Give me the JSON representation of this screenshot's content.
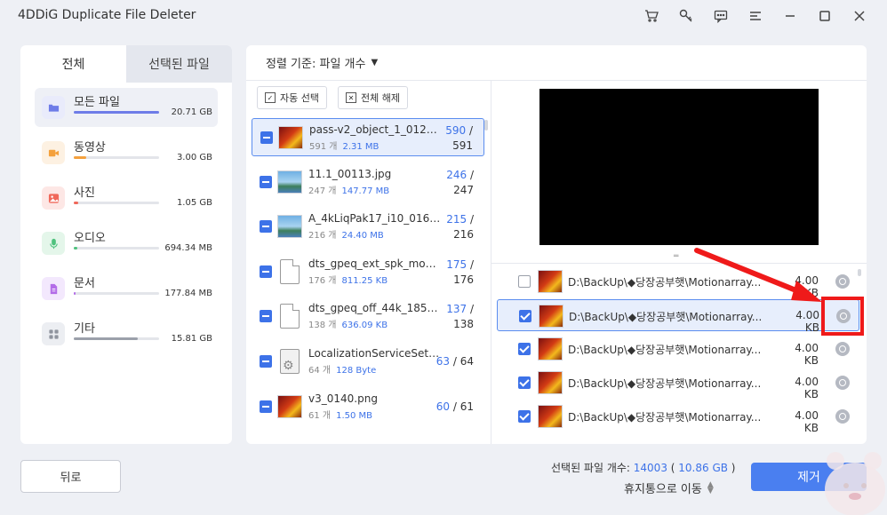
{
  "app": {
    "title": "4DDiG Duplicate File Deleter"
  },
  "titlebar_icons": [
    "cart-icon",
    "key-icon",
    "feedback-icon",
    "menu-icon",
    "minimize-icon",
    "maximize-icon",
    "close-icon"
  ],
  "tabs": {
    "all": "전체",
    "selected": "선택된 파일"
  },
  "categories": [
    {
      "name": "모든 파일",
      "size": "20.71 GB",
      "fill": 1.0,
      "color": "#6e7ce8",
      "icon": "folder-icon",
      "bg": "#e9ebfb"
    },
    {
      "name": "동영상",
      "size": "3.00 GB",
      "fill": 0.15,
      "color": "#f4a13d",
      "icon": "video-icon",
      "bg": "#fdf1e2"
    },
    {
      "name": "사진",
      "size": "1.05 GB",
      "fill": 0.05,
      "color": "#f0685a",
      "icon": "image-icon",
      "bg": "#fde7e5"
    },
    {
      "name": "오디오",
      "size": "694.34 MB",
      "fill": 0.04,
      "color": "#4fc27e",
      "icon": "microphone-icon",
      "bg": "#e4f6ea"
    },
    {
      "name": "문서",
      "size": "177.84 MB",
      "fill": 0.02,
      "color": "#b36ce8",
      "icon": "document-icon",
      "bg": "#f3e8fd"
    },
    {
      "name": "기타",
      "size": "15.81 GB",
      "fill": 0.75,
      "color": "#9ba0aa",
      "icon": "grid-icon",
      "bg": "#eceef2"
    }
  ],
  "sort": {
    "label": "정렬 기준: 파일 개수"
  },
  "toolbar": {
    "auto_select": "자동 선택",
    "deselect_all": "전체 해제"
  },
  "files": [
    {
      "name": "pass-v2_object_1_0120....",
      "count": "591 개",
      "size": "2.31 MB",
      "selected": "590",
      "total": "591",
      "thumb": "flower",
      "layout": "stack"
    },
    {
      "name": "11.1_00113.jpg",
      "count": "247 개",
      "size": "147.77 MB",
      "selected": "246",
      "total": "247",
      "thumb": "land",
      "layout": "stack"
    },
    {
      "name": "A_4kLiqPak17_i10_0160...",
      "count": "216 개",
      "size": "24.40 MB",
      "selected": "215",
      "total": "216",
      "thumb": "land",
      "layout": "stack"
    },
    {
      "name": "dts_gpeq_ext_spk_mod...",
      "count": "176 개",
      "size": "811.25 KB",
      "selected": "175",
      "total": "176",
      "thumb": "doc",
      "layout": "stack"
    },
    {
      "name": "dts_gpeq_off_44k_1854...",
      "count": "138 개",
      "size": "636.09 KB",
      "selected": "137",
      "total": "138",
      "thumb": "doc",
      "layout": "stack"
    },
    {
      "name": "LocalizationServiceSetti...",
      "count": "64 개",
      "size": "128 Byte",
      "selected": "63",
      "total": "64",
      "thumb": "gear",
      "layout": "inline"
    },
    {
      "name": "v3_0140.png",
      "count": "61 개",
      "size": "1.50 MB",
      "selected": "60",
      "total": "61",
      "thumb": "flower",
      "layout": "inline"
    }
  ],
  "duplicates": [
    {
      "path": "D:\\BackUp\\◆당장공부햇\\Motionarray...",
      "size": "4.00 KB",
      "checked": false
    },
    {
      "path": "D:\\BackUp\\◆당장공부햇\\Motionarray...",
      "size": "4.00 KB",
      "checked": true
    },
    {
      "path": "D:\\BackUp\\◆당장공부햇\\Motionarray...",
      "size": "4.00 KB",
      "checked": true
    },
    {
      "path": "D:\\BackUp\\◆당장공부햇\\Motionarray...",
      "size": "4.00 KB",
      "checked": true
    },
    {
      "path": "D:\\BackUp\\◆당장공부햇\\Motionarray...",
      "size": "4.00 KB",
      "checked": true
    }
  ],
  "bottom": {
    "back": "뒤로",
    "summary_prefix": "선택된 파일 개수: ",
    "summary_count": "14003",
    "summary_open": " ( ",
    "summary_size": "10.86 GB",
    "summary_close": " )",
    "trash": "휴지통으로 이동",
    "remove": "제거"
  }
}
